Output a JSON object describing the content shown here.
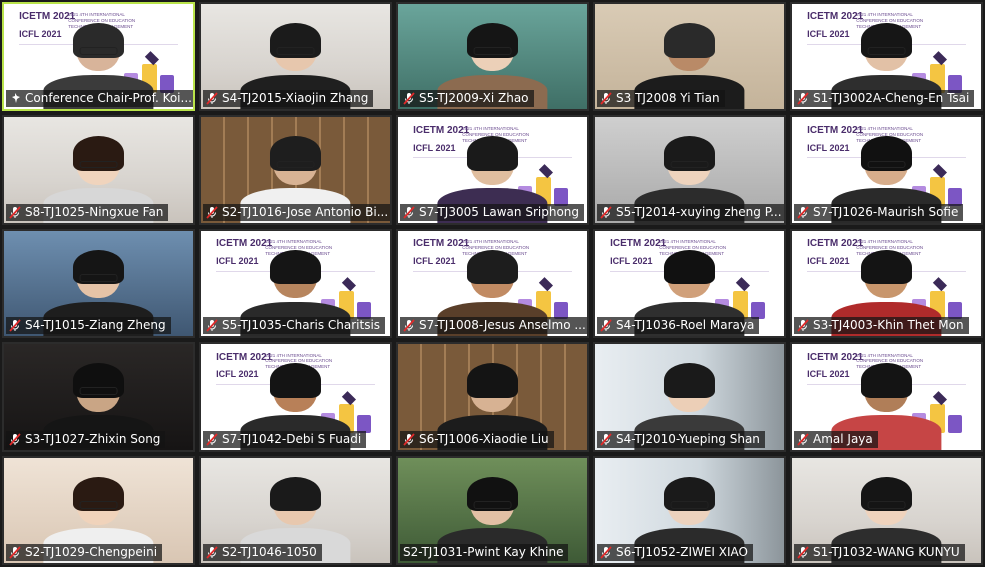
{
  "conference": {
    "title_line1": "ICETM 2021",
    "title_line2": "ICFL 2021",
    "subtitle": "2021 4TH INTERNATIONAL CONFERENCE ON EDUCATION TECHNOLOGY MANAGEMENT"
  },
  "participants": [
    {
      "name": "Conference Chair-Prof. Koi...",
      "muted": true,
      "mic_icon": "pin-icon",
      "active": true
    },
    {
      "name": "S4-TJ2015-Xiaojin Zhang",
      "muted": true
    },
    {
      "name": "S5-TJ2009-Xi Zhao",
      "muted": true
    },
    {
      "name": "S3 TJ2008 Yi Tian",
      "muted": true
    },
    {
      "name": "S1-TJ3002A-Cheng-En Tsai",
      "muted": true
    },
    {
      "name": "S8-TJ1025-Ningxue Fan",
      "muted": true
    },
    {
      "name": "S2-TJ1016-Jose Antonio Bi...",
      "muted": true
    },
    {
      "name": "S7-TJ3005 Lawan Sriphong",
      "muted": true
    },
    {
      "name": "S5-TJ2014-xuying zheng P...",
      "muted": true
    },
    {
      "name": "S7-TJ1026-Maurish Sofie",
      "muted": true
    },
    {
      "name": "S4-TJ1015-Ziang Zheng",
      "muted": true
    },
    {
      "name": "S5-TJ1035-Charis Charitsis",
      "muted": true
    },
    {
      "name": "S7-TJ1008-Jesus Anselmo ...",
      "muted": true
    },
    {
      "name": "S4-TJ1036-Roel Maraya",
      "muted": true
    },
    {
      "name": "S3-TJ4003-Khin Thet Mon",
      "muted": true
    },
    {
      "name": "S3-TJ1027-Zhixin Song",
      "muted": true
    },
    {
      "name": "S7-TJ1042-Debi S Fuadi",
      "muted": true
    },
    {
      "name": "S6-TJ1006-Xiaodie Liu",
      "muted": true
    },
    {
      "name": "S4-TJ2010-Yueping Shan",
      "muted": true
    },
    {
      "name": "Amal Jaya",
      "muted": true
    },
    {
      "name": "S2-TJ1029-Chengpeini",
      "muted": true
    },
    {
      "name": "S2-TJ1046-1050",
      "muted": true
    },
    {
      "name": "S2-TJ1031-Pwint Kay Khine",
      "muted": false
    },
    {
      "name": "S6-TJ1052-ZIWEI XIAO",
      "muted": true
    },
    {
      "name": "S1-TJ1032-WANG KUNYU",
      "muted": true
    }
  ],
  "colors": {
    "active_border": "#b9e34a",
    "muted_icon": "#e02a2a",
    "label_bg": "rgba(20,20,20,0.72)"
  }
}
